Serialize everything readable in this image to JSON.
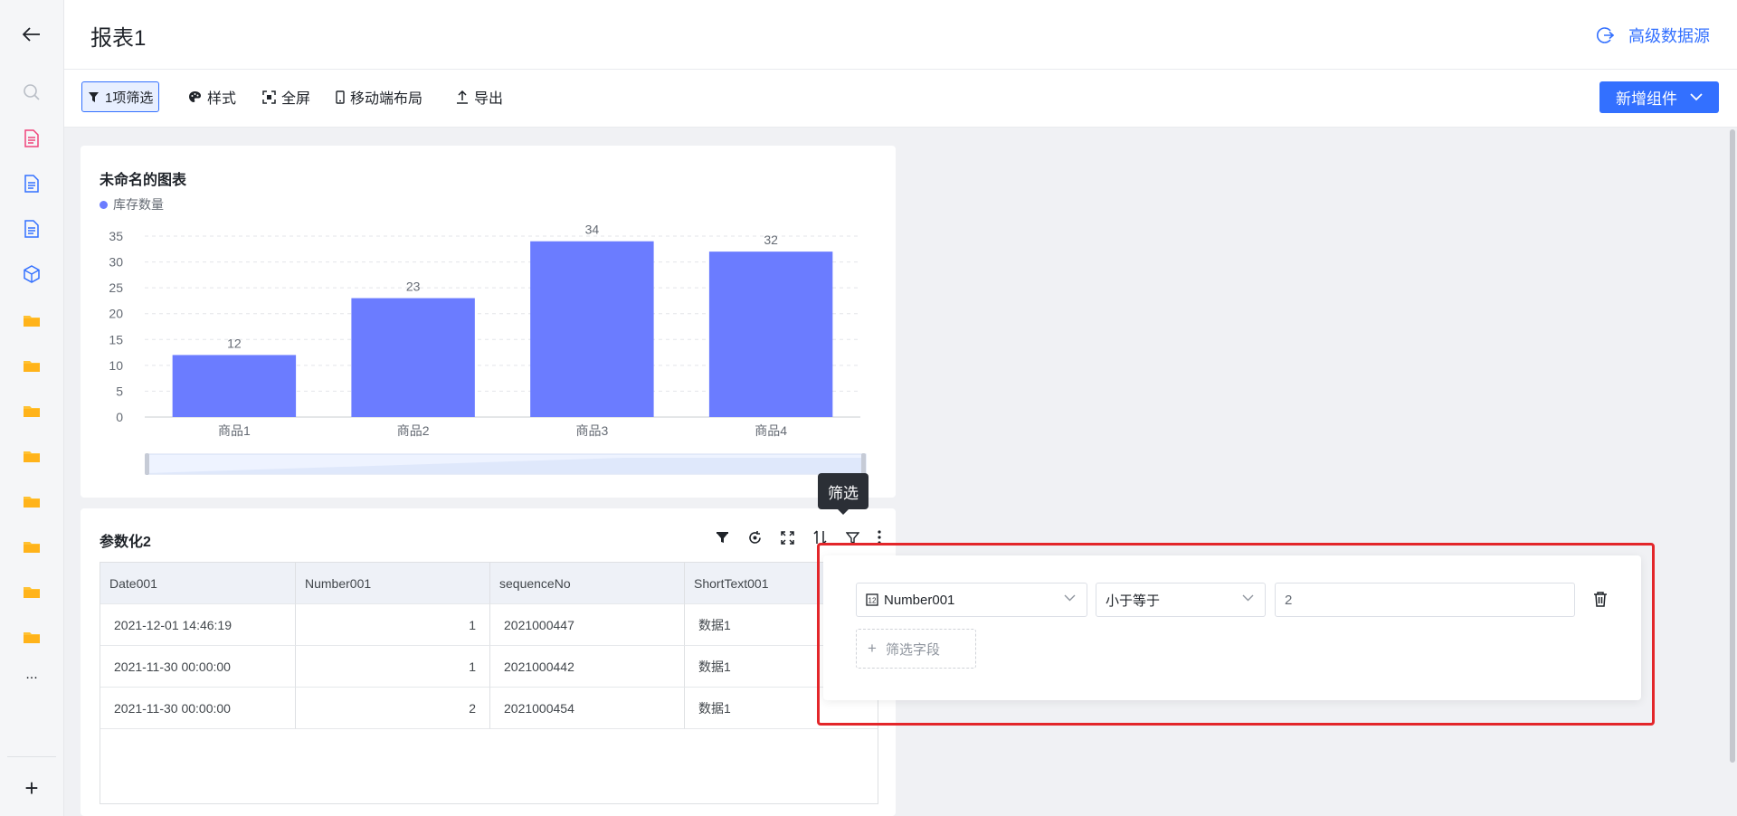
{
  "header": {
    "title": "报表1",
    "advanced_source_label": "高级数据源"
  },
  "toolbar": {
    "filter_label": "1项筛选",
    "style_label": "样式",
    "fullscreen_label": "全屏",
    "mobile_layout_label": "移动端布局",
    "export_label": "导出",
    "add_component_label": "新增组件"
  },
  "sidebar": {
    "more_label": "...",
    "add_label": "+"
  },
  "chart_card": {
    "title": "未命名的图表",
    "legend_label": "库存数量"
  },
  "chart_data": {
    "type": "bar",
    "title": "未命名的图表",
    "categories": [
      "商品1",
      "商品2",
      "商品3",
      "商品4"
    ],
    "series": [
      {
        "name": "库存数量",
        "values": [
          12,
          23,
          34,
          32
        ]
      }
    ],
    "ylim": [
      0,
      35
    ],
    "yticks": [
      0,
      5,
      10,
      15,
      20,
      25,
      30,
      35
    ],
    "grid": true,
    "legend": "top-left",
    "colors": {
      "bar": "#6b7cff"
    }
  },
  "table_card": {
    "title": "参数化2",
    "columns": [
      "Date001",
      "Number001",
      "sequenceNo",
      "ShortText001"
    ],
    "rows": [
      [
        "2021-12-01 14:46:19",
        "1",
        "2021000447",
        "数据1"
      ],
      [
        "2021-11-30 00:00:00",
        "1",
        "2021000442",
        "数据1"
      ],
      [
        "2021-11-30 00:00:00",
        "2",
        "2021000454",
        "数据1"
      ]
    ]
  },
  "tooltip": {
    "text": "筛选"
  },
  "filter_popover": {
    "field_value": "Number001",
    "operator_value": "小于等于",
    "input_value": "2",
    "add_field_label": "筛选字段"
  },
  "colors": {
    "accent": "#3370ff",
    "bar": "#6b7cff",
    "highlight": "#e3262a"
  }
}
